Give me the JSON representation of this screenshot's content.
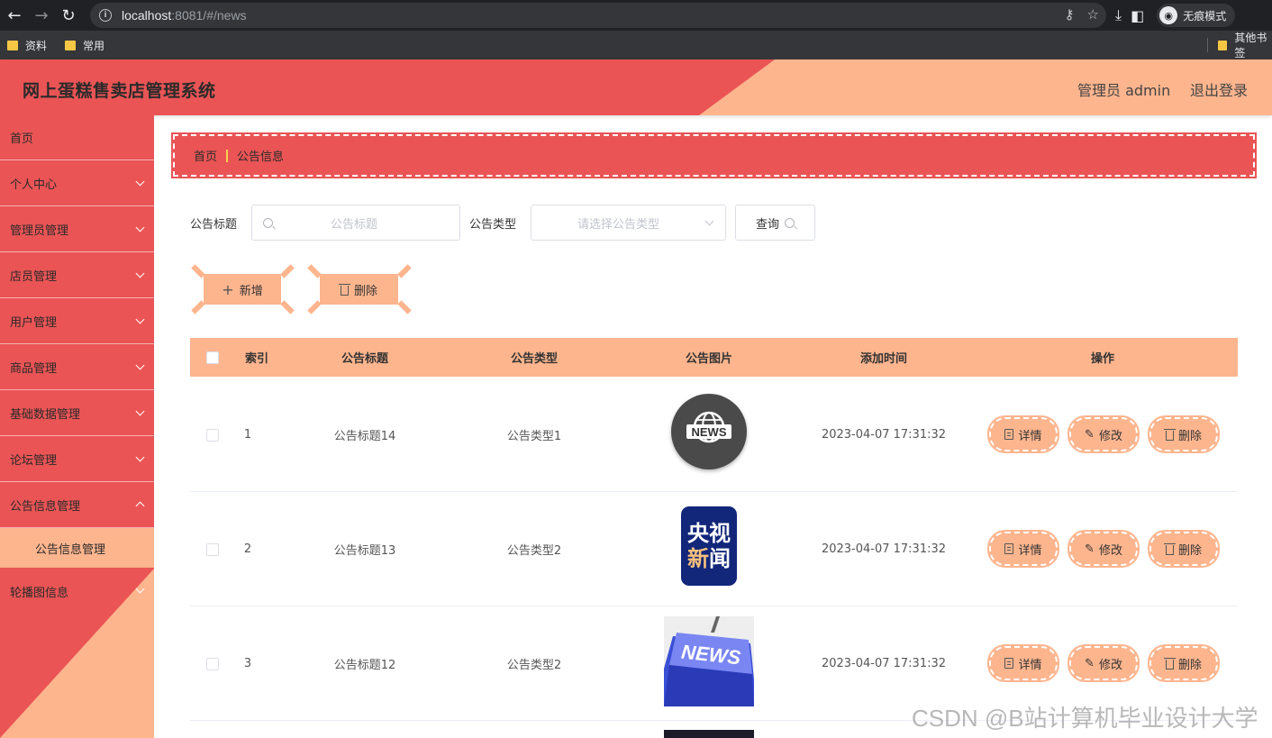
{
  "browser": {
    "url_host": "localhost",
    "url_rest": ":8081/#/news",
    "incognito_label": "无痕模式",
    "bookmarks": [
      "资料",
      "常用"
    ],
    "other_bookmarks": "其他书签"
  },
  "header": {
    "title": "网上蛋糕售卖店管理系统",
    "user": "管理员 admin",
    "logout": "退出登录"
  },
  "sidebar": {
    "items": [
      {
        "label": "首页"
      },
      {
        "label": "个人中心"
      },
      {
        "label": "管理员管理"
      },
      {
        "label": "店员管理"
      },
      {
        "label": "用户管理"
      },
      {
        "label": "商品管理"
      },
      {
        "label": "基础数据管理"
      },
      {
        "label": "论坛管理"
      },
      {
        "label": "公告信息管理"
      },
      {
        "label": "轮播图信息"
      }
    ],
    "active_sub": "公告信息管理"
  },
  "breadcrumb": {
    "home": "首页",
    "current": "公告信息"
  },
  "search": {
    "title_label": "公告标题",
    "title_placeholder": "公告标题",
    "type_label": "公告类型",
    "type_placeholder": "请选择公告类型",
    "query_button": "查询"
  },
  "actions": {
    "add": "新增",
    "delete": "删除"
  },
  "table": {
    "headers": {
      "index": "索引",
      "title": "公告标题",
      "type": "公告类型",
      "image": "公告图片",
      "time": "添加时间",
      "ops": "操作"
    },
    "rows": [
      {
        "index": "1",
        "title": "公告标题14",
        "type": "公告类型1",
        "time": "2023-04-07 17:31:32"
      },
      {
        "index": "2",
        "title": "公告标题13",
        "type": "公告类型2",
        "time": "2023-04-07 17:31:32"
      },
      {
        "index": "3",
        "title": "公告标题12",
        "type": "公告类型2",
        "time": "2023-04-07 17:31:32"
      }
    ],
    "op_labels": {
      "detail": "详情",
      "edit": "修改",
      "delete": "删除"
    },
    "images": {
      "news_badge": "NEWS",
      "cctv_line1": "央视",
      "cctv_line2": "新闻",
      "key_text": "NEWS"
    }
  },
  "watermark": "CSDN @B站计算机毕业设计大学"
}
